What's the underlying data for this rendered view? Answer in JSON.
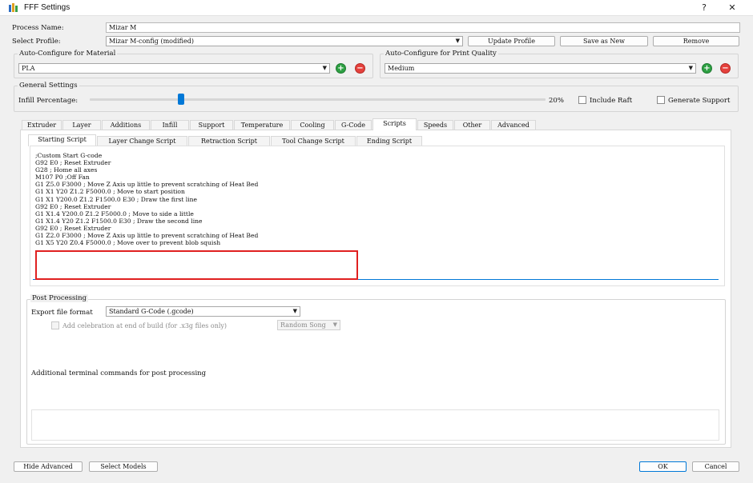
{
  "window": {
    "title": "FFF Settings",
    "help_glyph": "?",
    "close_glyph": "✕"
  },
  "process": {
    "label": "Process Name:",
    "value": "Mizar M"
  },
  "profile": {
    "label": "Select Profile:",
    "value": "Mizar M-config (modified)",
    "update_label": "Update Profile",
    "save_new_label": "Save as New",
    "remove_label": "Remove"
  },
  "material": {
    "title": "Auto-Configure for Material",
    "value": "PLA"
  },
  "quality": {
    "title": "Auto-Configure for Print Quality",
    "value": "Medium"
  },
  "general": {
    "title": "General Settings",
    "infill_label": "Infill Percentage:",
    "infill_percent": 20,
    "infill_value_text": "20%",
    "include_raft_label": "Include Raft",
    "generate_support_label": "Generate Support"
  },
  "tabs": [
    "Extruder",
    "Layer",
    "Additions",
    "Infill",
    "Support",
    "Temperature",
    "Cooling",
    "G-Code",
    "Scripts",
    "Speeds",
    "Other",
    "Advanced"
  ],
  "active_tab": "Scripts",
  "subtabs": [
    "Starting Script",
    "Layer Change Script",
    "Retraction Script",
    "Tool Change Script",
    "Ending Script"
  ],
  "active_subtab": "Starting Script",
  "script_lines": [
    ";Custom Start G-code",
    "G92 E0 ; Reset Extruder",
    "G28 ; Home all axes",
    "M107 P0 ;Off Fan",
    "G1 Z5.0 F3000 ; Move Z Axis up little to prevent scratching of Heat Bed",
    "G1 X1 Y20 Z1.2 F5000.0 ; Move to start position",
    "G1 X1 Y200.0 Z1.2 F1500.0 E30 ; Draw the first line",
    "G92 E0 ; Reset Extruder",
    "G1 X1.4 Y200.0 Z1.2 F5000.0 ; Move to side a little",
    "G1 X1.4 Y20 Z1.2 F1500.0 E30 ; Draw the second line",
    "G92 E0 ; Reset Extruder",
    "G1 Z2.0 F3000 ; Move Z Axis up little to prevent scratching of Heat Bed",
    "G1 X5 Y20 Z0.4 F5000.0 ; Move over to prevent blob squish"
  ],
  "post": {
    "title": "Post Processing",
    "export_label": "Export file format",
    "export_value": "Standard G-Code (.gcode)",
    "celebration_label": "Add celebration at end of build (for .x3g files only)",
    "song_value": "Random Song",
    "terminal_label": "Additional terminal commands for post processing"
  },
  "footer": {
    "hide_advanced": "Hide Advanced",
    "select_models": "Select Models",
    "ok": "OK",
    "cancel": "Cancel"
  },
  "colors": {
    "accent": "#0078d7",
    "highlight_box": "#e02020",
    "add": "#2ea043",
    "remove": "#e5413c"
  }
}
